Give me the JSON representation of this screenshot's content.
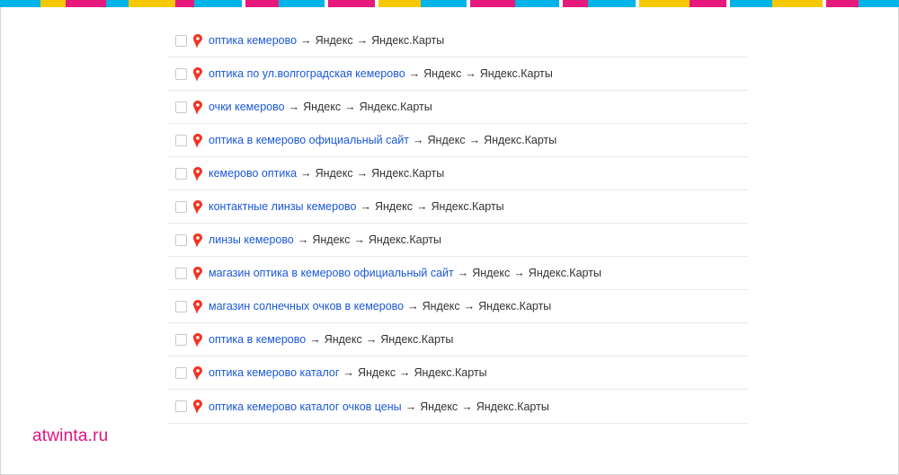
{
  "colors": {
    "link": "#1a58d8",
    "pin": "#f33321",
    "brand": "#e0127f",
    "stripe": [
      "#00b3e8",
      "#f6c800",
      "#e8197d"
    ]
  },
  "icons": {
    "checkbox": "checkbox-icon",
    "pin": "location-pin-icon"
  },
  "results": [
    {
      "query": "оптика кемерово",
      "arrow1": "→",
      "source": "Яндекс",
      "arrow2": "→",
      "service": "Яндекс.Карты"
    },
    {
      "query": "оптика по ул.волгоградская кемерово",
      "arrow1": "→",
      "source": "Яндекс",
      "arrow2": "→",
      "service": "Яндекс.Карты"
    },
    {
      "query": "очки кемерово",
      "arrow1": "→",
      "source": "Яндекс",
      "arrow2": "→",
      "service": "Яндекс.Карты"
    },
    {
      "query": "оптика в кемерово официальный сайт",
      "arrow1": "→",
      "source": "Яндекс",
      "arrow2": "→",
      "service": "Яндекс.Карты"
    },
    {
      "query": "кемерово оптика",
      "arrow1": "→",
      "source": "Яндекс",
      "arrow2": "→",
      "service": "Яндекс.Карты"
    },
    {
      "query": "контактные линзы кемерово",
      "arrow1": "→",
      "source": "Яндекс",
      "arrow2": "→",
      "service": "Яндекс.Карты"
    },
    {
      "query": "линзы кемерово",
      "arrow1": "→",
      "source": "Яндекс",
      "arrow2": "→",
      "service": "Яндекс.Карты"
    },
    {
      "query": "магазин оптика в кемерово официальный сайт",
      "arrow1": "→",
      "source": "Яндекс",
      "arrow2": "→",
      "service": "Яндекс.Карты"
    },
    {
      "query": "магазин солнечных очков в кемерово",
      "arrow1": "→",
      "source": "Яндекс",
      "arrow2": "→",
      "service": "Яндекс.Карты"
    },
    {
      "query": "оптика в кемерово",
      "arrow1": "→",
      "source": "Яндекс",
      "arrow2": "→",
      "service": "Яндекс.Карты"
    },
    {
      "query": "оптика кемерово каталог",
      "arrow1": "→",
      "source": "Яндекс",
      "arrow2": "→",
      "service": "Яндекс.Карты"
    },
    {
      "query": "оптика кемерово каталог очков цены",
      "arrow1": "→",
      "source": "Яндекс",
      "arrow2": "→",
      "service": "Яндекс.Карты"
    }
  ],
  "brand": {
    "label": "atwinta.ru"
  }
}
